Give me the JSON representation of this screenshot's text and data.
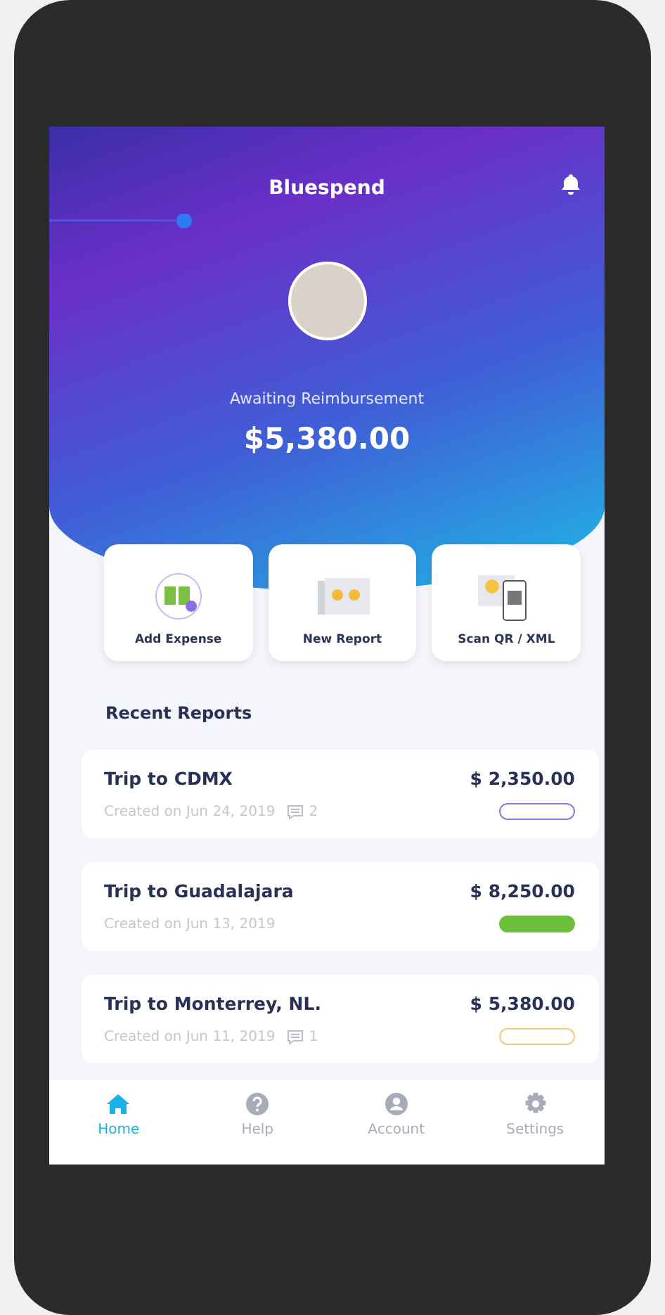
{
  "app_bar": {
    "title": "Bluespend"
  },
  "summary": {
    "label": "Awaiting Reimbursement",
    "amount": "$5,380.00"
  },
  "actions": [
    {
      "label": "Add Expense",
      "kind": "expense"
    },
    {
      "label": "New Report",
      "kind": "report"
    },
    {
      "label": "Scan QR / XML",
      "kind": "scan"
    }
  ],
  "section_title": "Recent Reports",
  "reports": [
    {
      "title": "Trip to CDMX",
      "created": "Created on Jun 24, 2019",
      "comments": "2",
      "amount": "$ 2,350.00",
      "status": {
        "color": "#8a7be0",
        "filled": false
      }
    },
    {
      "title": "Trip to Guadalajara",
      "created": "Created on Jun 13, 2019",
      "amount": "$ 8,250.00",
      "status": {
        "color": "#6cbf3a",
        "filled": true
      }
    },
    {
      "title": "Trip to Monterrey, NL.",
      "created": "Created on Jun 11, 2019",
      "comments": "1",
      "amount": "$ 5,380.00",
      "status": {
        "color": "#f5c97a",
        "filled": false
      }
    }
  ],
  "tabs": [
    {
      "label": "Home",
      "kind": "home",
      "selected": true
    },
    {
      "label": "Help",
      "kind": "help",
      "selected": false
    },
    {
      "label": "Account",
      "kind": "account",
      "selected": false
    },
    {
      "label": "Settings",
      "kind": "settings",
      "selected": false
    }
  ]
}
